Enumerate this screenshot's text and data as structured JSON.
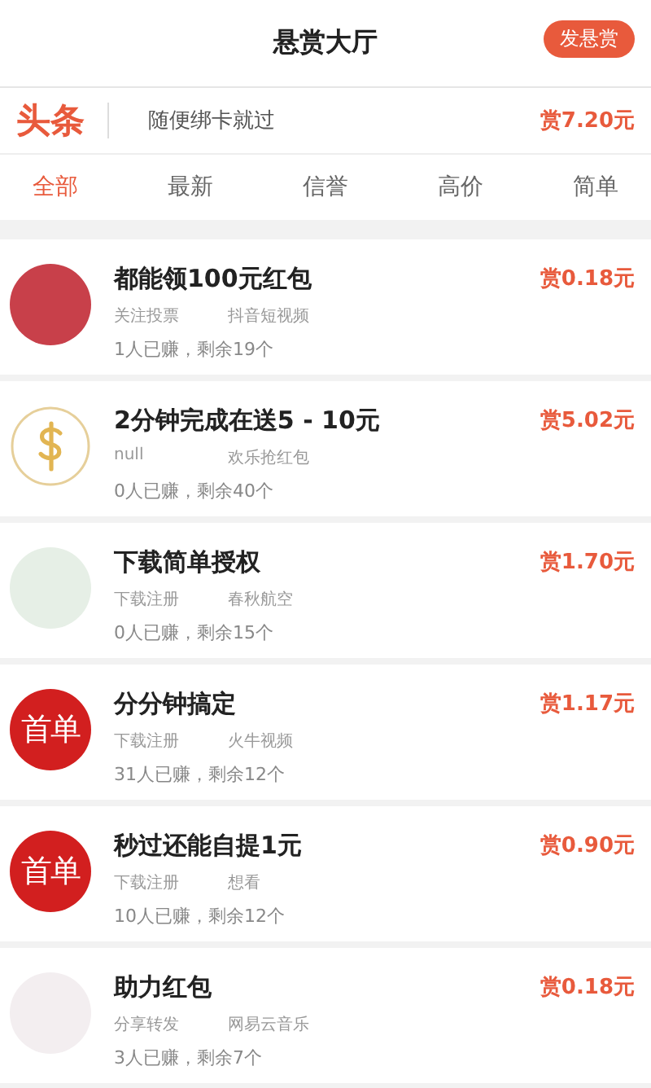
{
  "header": {
    "title": "悬赏大厅",
    "action": "发悬赏"
  },
  "headline": {
    "logo": "头条",
    "text": "随便绑卡就过",
    "reward": "赏7.20元"
  },
  "tabs": [
    {
      "label": "全部",
      "selected": true
    },
    {
      "label": "最新",
      "selected": false
    },
    {
      "label": "信誉",
      "selected": false
    },
    {
      "label": "高价",
      "selected": false
    },
    {
      "label": "简单",
      "selected": false
    }
  ],
  "tasks": [
    {
      "avatar": {
        "kind": "photo",
        "color": "#c8404a"
      },
      "title": "都能领100元红包",
      "tag": "关注投票",
      "app": "抖音短视频",
      "stats": "1人已赚，剩余19个",
      "reward": "赏0.18元"
    },
    {
      "avatar": {
        "kind": "dollar"
      },
      "title": "2分钟完成在送5 - 10元",
      "tag": "null",
      "app": "欢乐抢红包",
      "stats": "0人已赚，剩余40个",
      "reward": "赏5.02元"
    },
    {
      "avatar": {
        "kind": "photo",
        "color": "#e6efe6"
      },
      "title": "下载简单授权",
      "tag": "下载注册",
      "app": "春秋航空",
      "stats": "0人已赚，剩余15个",
      "reward": "赏1.70元"
    },
    {
      "avatar": {
        "kind": "badge",
        "text": "首单"
      },
      "title": "分分钟搞定",
      "tag": "下载注册",
      "app": "火牛视频",
      "stats": "31人已赚，剩余12个",
      "reward": "赏1.17元"
    },
    {
      "avatar": {
        "kind": "badge",
        "text": "首单"
      },
      "title": "秒过还能自提1元",
      "tag": "下载注册",
      "app": "想看",
      "stats": "10人已赚，剩余12个",
      "reward": "赏0.90元"
    },
    {
      "avatar": {
        "kind": "photo",
        "color": "#f3eef0"
      },
      "title": "助力红包",
      "tag": "分享转发",
      "app": "网易云音乐",
      "stats": "3人已赚，剩余7个",
      "reward": "赏0.18元"
    }
  ]
}
